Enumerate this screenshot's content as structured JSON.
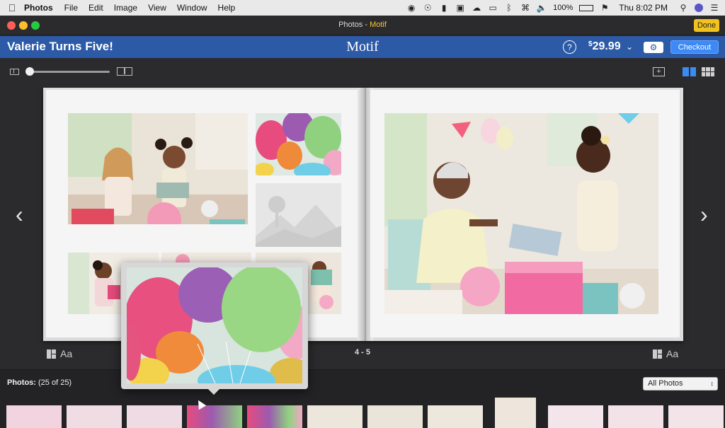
{
  "menubar": {
    "app_name": "Photos",
    "items": [
      "File",
      "Edit",
      "Image",
      "View",
      "Window",
      "Help"
    ],
    "battery": "100%",
    "clock": "Thu 8:02 PM"
  },
  "window": {
    "title_app": "Photos",
    "title_separator": " - ",
    "title_ext": "Motif",
    "done_label": "Done"
  },
  "header": {
    "project_title": "Valerie Turns Five!",
    "brand": "Motif",
    "help_symbol": "?",
    "price_symbol": "$",
    "price_value": "29.99",
    "checkout_label": "Checkout"
  },
  "book": {
    "page_numbers": "4 - 5",
    "text_tool_label": "Aa"
  },
  "photos": {
    "label": "Photos:",
    "count": "(25 of 25)",
    "filter_selected": "All Photos"
  },
  "colors": {
    "accent_blue": "#2c5aa7",
    "checkout_blue": "#3d8af7",
    "done_yellow": "#f2c21f"
  }
}
